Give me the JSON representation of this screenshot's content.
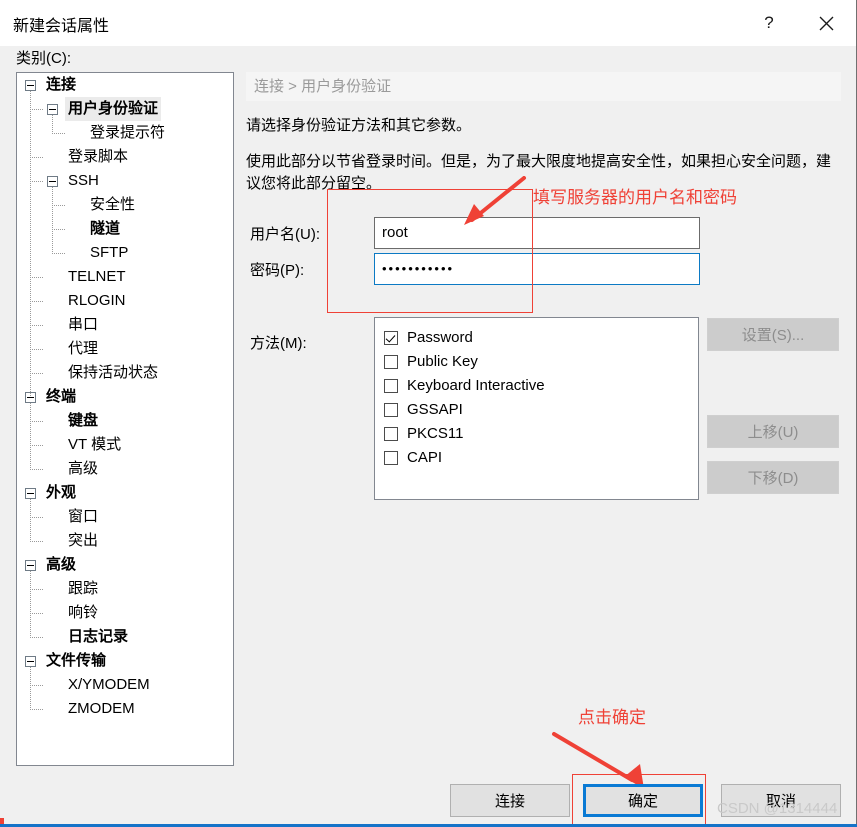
{
  "window": {
    "title": "新建会话属性",
    "help_icon": "question-mark-icon",
    "close_icon": "close-icon"
  },
  "sidebar": {
    "label": "类别(C):",
    "items": [
      {
        "label": "连接",
        "level": 0,
        "bold": true,
        "expander": "collapse",
        "selected": false
      },
      {
        "label": "用户身份验证",
        "level": 1,
        "bold": true,
        "expander": "collapse",
        "selected": true
      },
      {
        "label": "登录提示符",
        "level": 2,
        "bold": false,
        "expander": "none",
        "selected": false
      },
      {
        "label": "登录脚本",
        "level": 1,
        "bold": false,
        "expander": "none",
        "selected": false
      },
      {
        "label": "SSH",
        "level": 1,
        "bold": false,
        "expander": "collapse",
        "selected": false
      },
      {
        "label": "安全性",
        "level": 2,
        "bold": false,
        "expander": "none",
        "selected": false
      },
      {
        "label": "隧道",
        "level": 2,
        "bold": true,
        "expander": "none",
        "selected": false
      },
      {
        "label": "SFTP",
        "level": 2,
        "bold": false,
        "expander": "none",
        "selected": false
      },
      {
        "label": "TELNET",
        "level": 1,
        "bold": false,
        "expander": "none",
        "selected": false
      },
      {
        "label": "RLOGIN",
        "level": 1,
        "bold": false,
        "expander": "none",
        "selected": false
      },
      {
        "label": "串口",
        "level": 1,
        "bold": false,
        "expander": "none",
        "selected": false
      },
      {
        "label": "代理",
        "level": 1,
        "bold": false,
        "expander": "none",
        "selected": false
      },
      {
        "label": "保持活动状态",
        "level": 1,
        "bold": false,
        "expander": "none",
        "selected": false
      },
      {
        "label": "终端",
        "level": 0,
        "bold": true,
        "expander": "collapse",
        "selected": false
      },
      {
        "label": "键盘",
        "level": 1,
        "bold": true,
        "expander": "none",
        "selected": false
      },
      {
        "label": "VT 模式",
        "level": 1,
        "bold": false,
        "expander": "none",
        "selected": false
      },
      {
        "label": "高级",
        "level": 1,
        "bold": false,
        "expander": "none",
        "selected": false
      },
      {
        "label": "外观",
        "level": 0,
        "bold": true,
        "expander": "collapse",
        "selected": false
      },
      {
        "label": "窗口",
        "level": 1,
        "bold": false,
        "expander": "none",
        "selected": false
      },
      {
        "label": "突出",
        "level": 1,
        "bold": false,
        "expander": "none",
        "selected": false
      },
      {
        "label": "高级",
        "level": 0,
        "bold": true,
        "expander": "collapse",
        "selected": false
      },
      {
        "label": "跟踪",
        "level": 1,
        "bold": false,
        "expander": "none",
        "selected": false
      },
      {
        "label": "响铃",
        "level": 1,
        "bold": false,
        "expander": "none",
        "selected": false
      },
      {
        "label": "日志记录",
        "level": 1,
        "bold": true,
        "expander": "none",
        "selected": false
      },
      {
        "label": "文件传输",
        "level": 0,
        "bold": true,
        "expander": "collapse",
        "selected": false
      },
      {
        "label": "X/YMODEM",
        "level": 1,
        "bold": false,
        "expander": "none",
        "selected": false
      },
      {
        "label": "ZMODEM",
        "level": 1,
        "bold": false,
        "expander": "none",
        "selected": false
      }
    ]
  },
  "content": {
    "breadcrumb": "连接 > 用户身份验证",
    "description_1": "请选择身份验证方法和其它参数。",
    "description_2": "使用此部分以节省登录时间。但是，为了最大限度地提高安全性，如果担心安全问题，建议您将此部分留空。",
    "username": {
      "label": "用户名(U):",
      "value": "root",
      "placeholder": ""
    },
    "password": {
      "label": "密码(P):",
      "value": "•••••••••••",
      "placeholder": ""
    },
    "methods": {
      "label": "方法(M):",
      "items": [
        {
          "label": "Password",
          "checked": true
        },
        {
          "label": "Public Key",
          "checked": false
        },
        {
          "label": "Keyboard Interactive",
          "checked": false
        },
        {
          "label": "GSSAPI",
          "checked": false
        },
        {
          "label": "PKCS11",
          "checked": false
        },
        {
          "label": "CAPI",
          "checked": false
        }
      ]
    },
    "side_buttons": {
      "setup": "设置(S)...",
      "move_up": "上移(U)",
      "move_down": "下移(D)"
    }
  },
  "footer": {
    "connect": "连接",
    "ok": "确定",
    "cancel": "取消",
    "watermark": "CSDN @1314444"
  },
  "annotations": {
    "credentials_note": "填写服务器的用户名和密码",
    "ok_note": "点击确定",
    "accent_color": "#ef4136",
    "focus_color": "#0a7ad4"
  }
}
